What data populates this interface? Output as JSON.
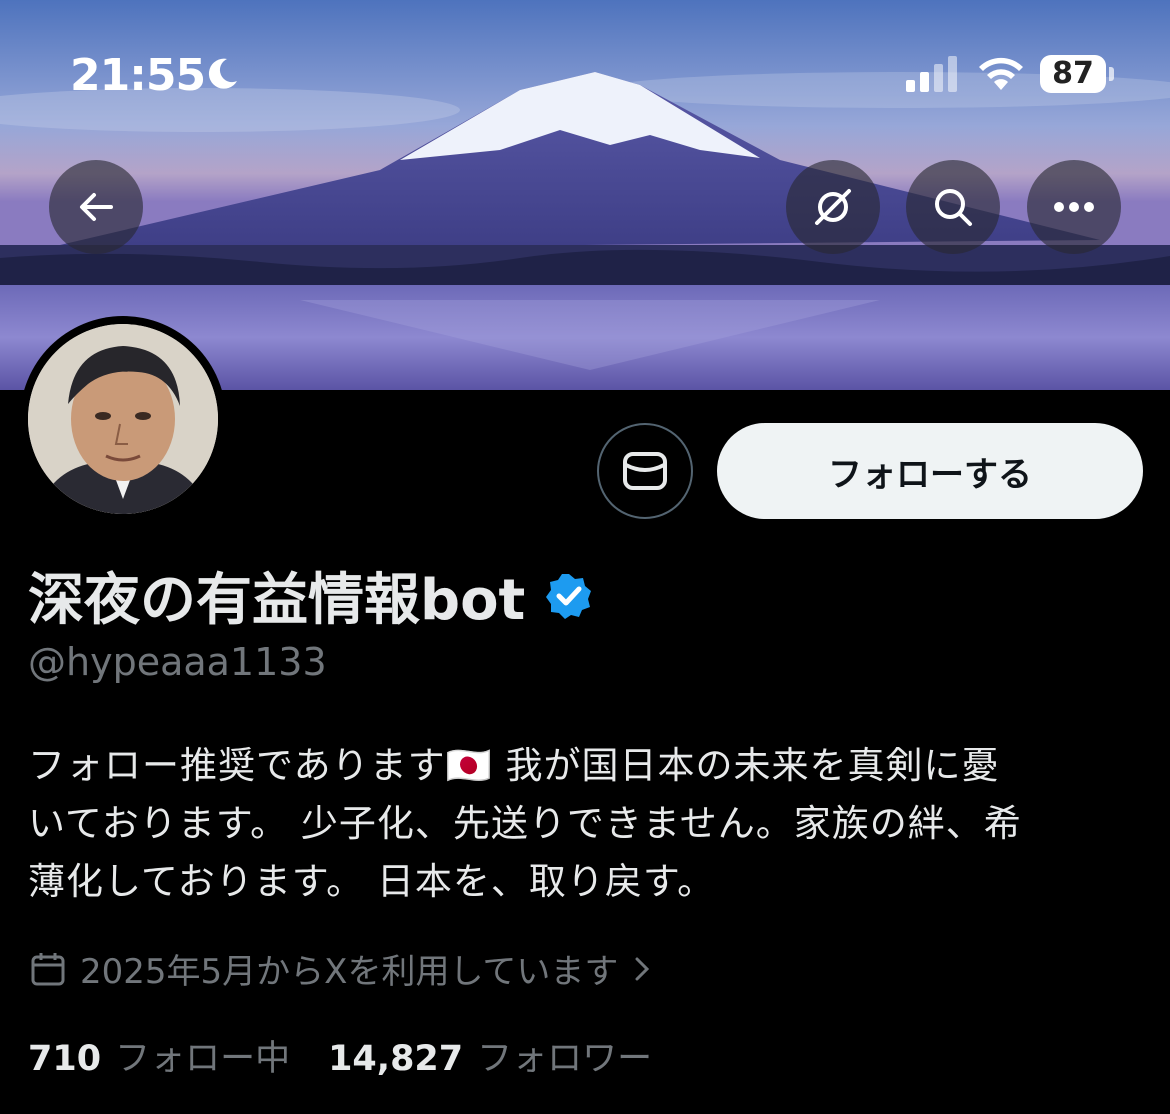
{
  "status_bar": {
    "time": "21:55",
    "battery": "87",
    "icons": [
      "moon-icon",
      "signal-icon",
      "wifi-icon",
      "battery-icon"
    ]
  },
  "header": {
    "icons": [
      "back-arrow-icon",
      "grok-icon",
      "search-icon",
      "more-icon"
    ]
  },
  "profile": {
    "display_name": "深夜の有益情報bot",
    "handle": "@hypeaaa1133",
    "bio_lines": [
      "フォロー推奨であります🇯🇵 我が国日本の未来を真剣に憂",
      "いております。 少子化、先送りできません。家族の絆、希",
      "薄化しております。 日本を、取り戻す。"
    ],
    "joined": "2025年5月からXを利用しています",
    "following_count": "710",
    "following_label": "フォロー中",
    "followers_count": "14,827",
    "followers_label": "フォロワー"
  },
  "actions": {
    "follow_label": "フォローする",
    "dm_icon": "message-icon"
  },
  "colors": {
    "background": "#000000",
    "verified": "#1d9bf0",
    "secondary_text": "#71767b",
    "follow_button_bg": "#eff3f4"
  }
}
